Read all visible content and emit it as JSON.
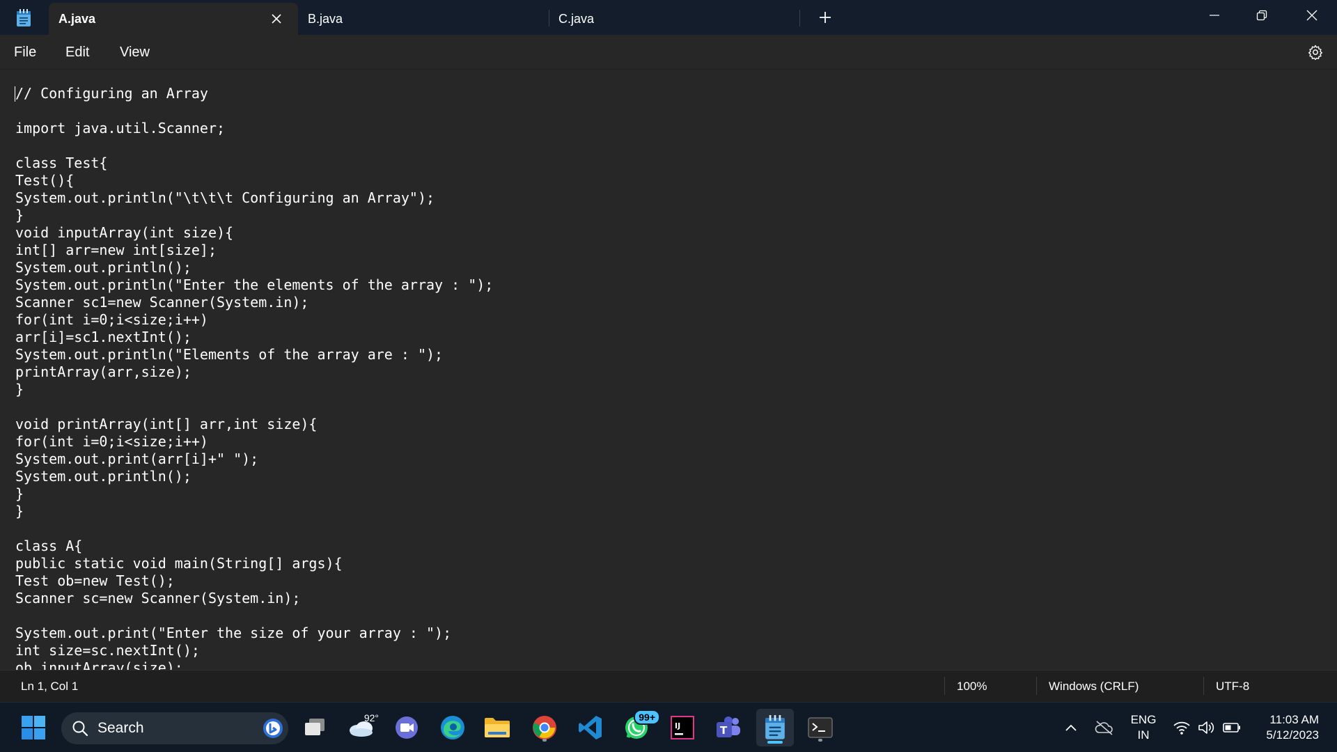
{
  "window": {
    "tabs": [
      {
        "label": "A.java",
        "active": true
      },
      {
        "label": "B.java",
        "active": false
      },
      {
        "label": "C.java",
        "active": false
      }
    ],
    "new_tab_icon": "plus-icon",
    "controls": [
      "minimize-icon",
      "restore-icon",
      "close-icon"
    ]
  },
  "menu": {
    "file": "File",
    "edit": "Edit",
    "view": "View",
    "settings_icon": "gear-icon"
  },
  "editor": {
    "lines": [
      "// Configuring an Array",
      "",
      "import java.util.Scanner;",
      "",
      "class Test{",
      "Test(){",
      "System.out.println(\"\\t\\t\\t Configuring an Array\");",
      "}",
      "void inputArray(int size){",
      "int[] arr=new int[size];",
      "System.out.println();",
      "System.out.println(\"Enter the elements of the array : \");",
      "Scanner sc1=new Scanner(System.in);",
      "for(int i=0;i<size;i++)",
      "arr[i]=sc1.nextInt();",
      "System.out.println(\"Elements of the array are : \");",
      "printArray(arr,size);",
      "}",
      "",
      "void printArray(int[] arr,int size){",
      "for(int i=0;i<size;i++)",
      "System.out.print(arr[i]+\" \");",
      "System.out.println();",
      "}",
      "}",
      "",
      "class A{",
      "public static void main(String[] args){",
      "Test ob=new Test();",
      "Scanner sc=new Scanner(System.in);",
      "",
      "System.out.print(\"Enter the size of your array : \");",
      "int size=sc.nextInt();",
      "ob.inputArray(size);"
    ]
  },
  "status": {
    "position": "Ln 1, Col 1",
    "zoom": "100%",
    "line_ending": "Windows (CRLF)",
    "encoding": "UTF-8"
  },
  "taskbar": {
    "search_placeholder": "Search",
    "weather_temp": "92°",
    "whatsapp_badge": "99+",
    "language_line1": "ENG",
    "language_line2": "IN",
    "time": "11:03 AM",
    "date": "5/12/2023"
  },
  "colors": {
    "titlebar": "#131d2b",
    "editor_bg": "#272727",
    "taskbar": "#0f1a26",
    "accent": "#4cc2ff"
  }
}
